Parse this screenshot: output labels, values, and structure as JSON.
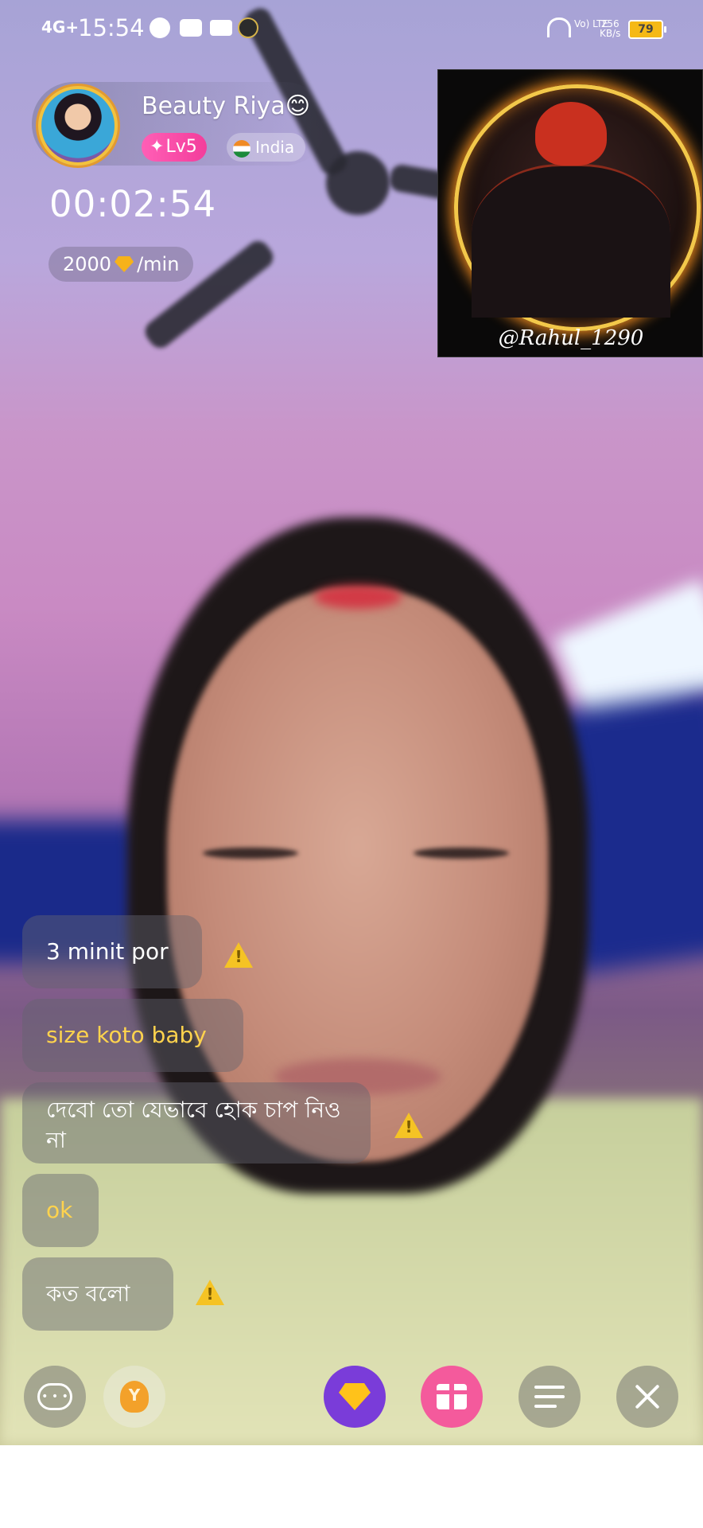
{
  "status_bar": {
    "signal": "4G+",
    "time": "15:54",
    "network": "Vo) LTE",
    "speed_value": "256",
    "speed_unit": "KB/s",
    "battery": "79"
  },
  "host": {
    "name": "Beauty Riya😊",
    "level": "Lv5",
    "country": "India"
  },
  "call": {
    "timer": "00:02:54",
    "rate_amount": "2000",
    "rate_unit": "/min"
  },
  "pip": {
    "handle": "@Rahul_1290"
  },
  "chat": {
    "messages": [
      {
        "text": "3 minit por",
        "highlight": false,
        "warning": true
      },
      {
        "text": "size koto baby",
        "highlight": true,
        "warning": false
      },
      {
        "text": "দেবো তো যেভাবে হোক চাপ নিও না",
        "highlight": false,
        "warning": true
      },
      {
        "text": "ok",
        "highlight": true,
        "warning": false
      },
      {
        "text": "কত বলো",
        "highlight": false,
        "warning": true
      }
    ]
  },
  "toolbar": {
    "icons": [
      "chat-icon",
      "tip-icon",
      "diamond-icon",
      "gift-icon",
      "menu-icon",
      "close-icon"
    ]
  },
  "colors": {
    "level_badge": "#f33d9b",
    "highlight_text": "#ffd34d",
    "diamond_button": "#7a3cd9",
    "gift_button": "#f45a9c",
    "warning": "#f5c324"
  }
}
